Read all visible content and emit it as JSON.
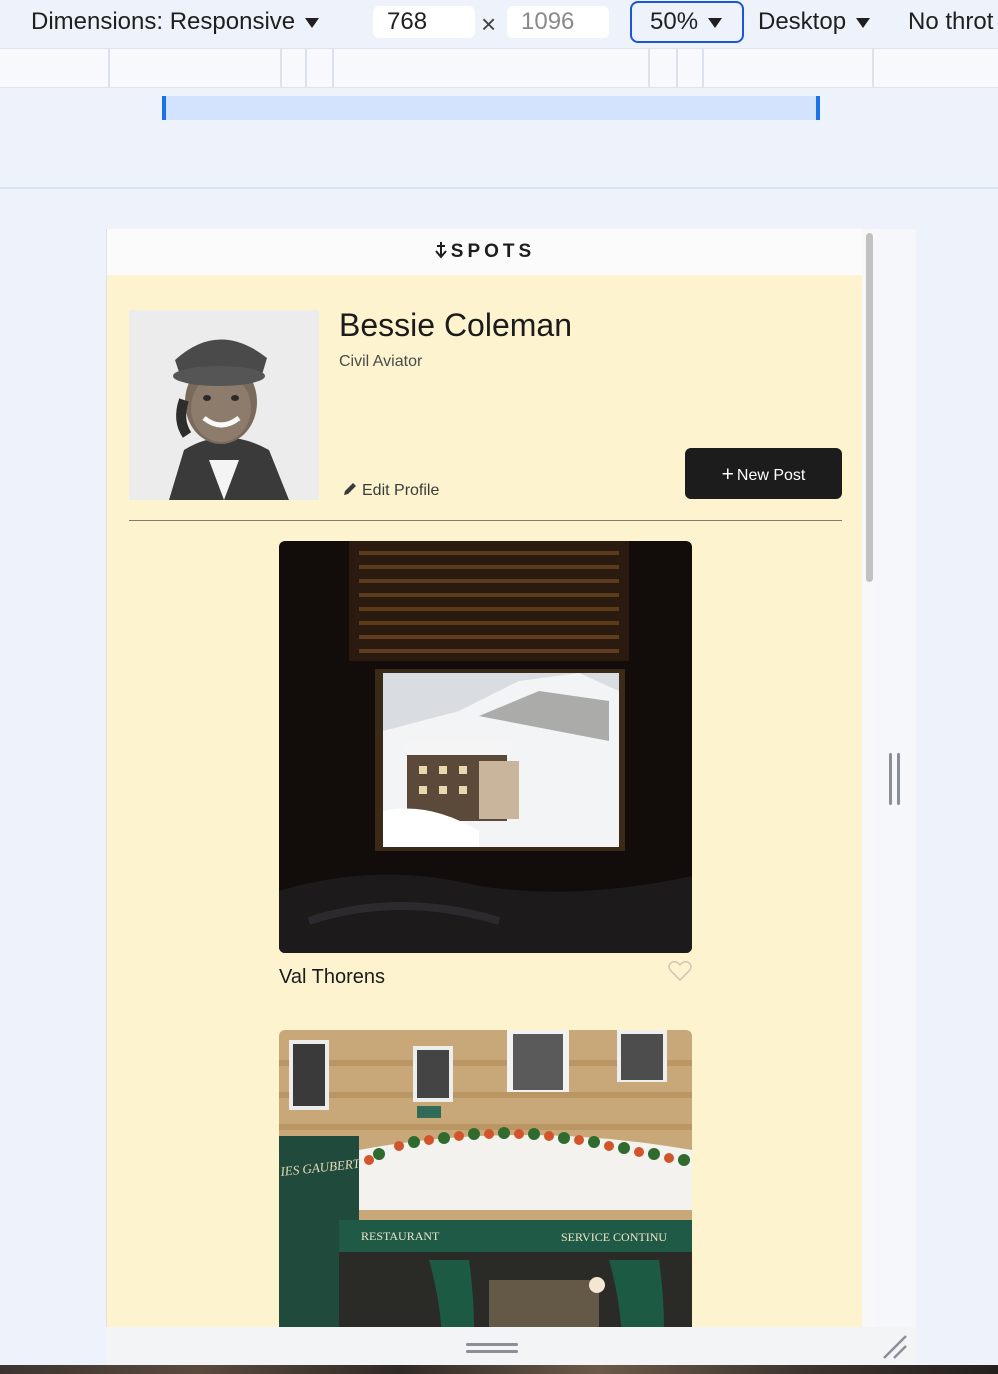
{
  "devtools": {
    "dimensions_label": "Dimensions: Responsive",
    "width_value": "768",
    "times_symbol": "×",
    "height_value": "1096",
    "zoom_label": "50%",
    "device_label": "Desktop",
    "throttle_label": "No throt"
  },
  "site": {
    "logo_text": "SPOTS"
  },
  "profile": {
    "name": "Bessie Coleman",
    "role": "Civil Aviator",
    "edit_label": "Edit Profile",
    "new_post_label": "New Post"
  },
  "cards": [
    {
      "title": "Val Thorens",
      "liked": false
    },
    {
      "title": "",
      "sign_left": "RESTAURANT",
      "sign_right": "SERVICE CONTINU",
      "sign_top": "IES GAUBERT"
    }
  ],
  "colors": {
    "page_background": "#fdf4cf",
    "button": "#1c1c1c",
    "devtools_accent": "#1a73e8"
  }
}
